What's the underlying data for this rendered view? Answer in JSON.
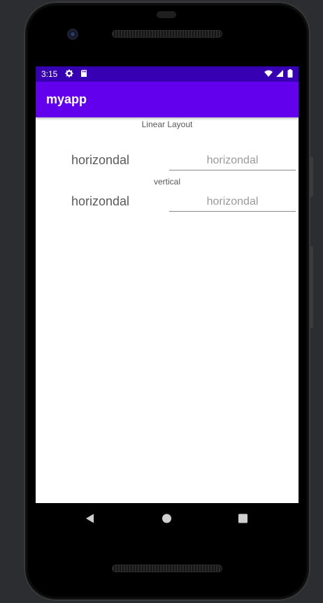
{
  "status_bar": {
    "time": "3:15",
    "color": "#3700b3",
    "icons": [
      "gear-icon",
      "sd-card-icon",
      "wifi-icon",
      "signal-icon",
      "battery-icon"
    ]
  },
  "app_bar": {
    "title": "myapp",
    "color": "#6200ee"
  },
  "content": {
    "header_label": "Linear Layout",
    "rows": [
      {
        "label": "horizondal",
        "input_placeholder": "horizondal"
      },
      {
        "label": "horizondal",
        "input_placeholder": "horizondal"
      }
    ],
    "vertical_label": "vertical"
  },
  "nav_bar": {
    "buttons": [
      "back-icon",
      "home-icon",
      "recents-icon"
    ]
  }
}
